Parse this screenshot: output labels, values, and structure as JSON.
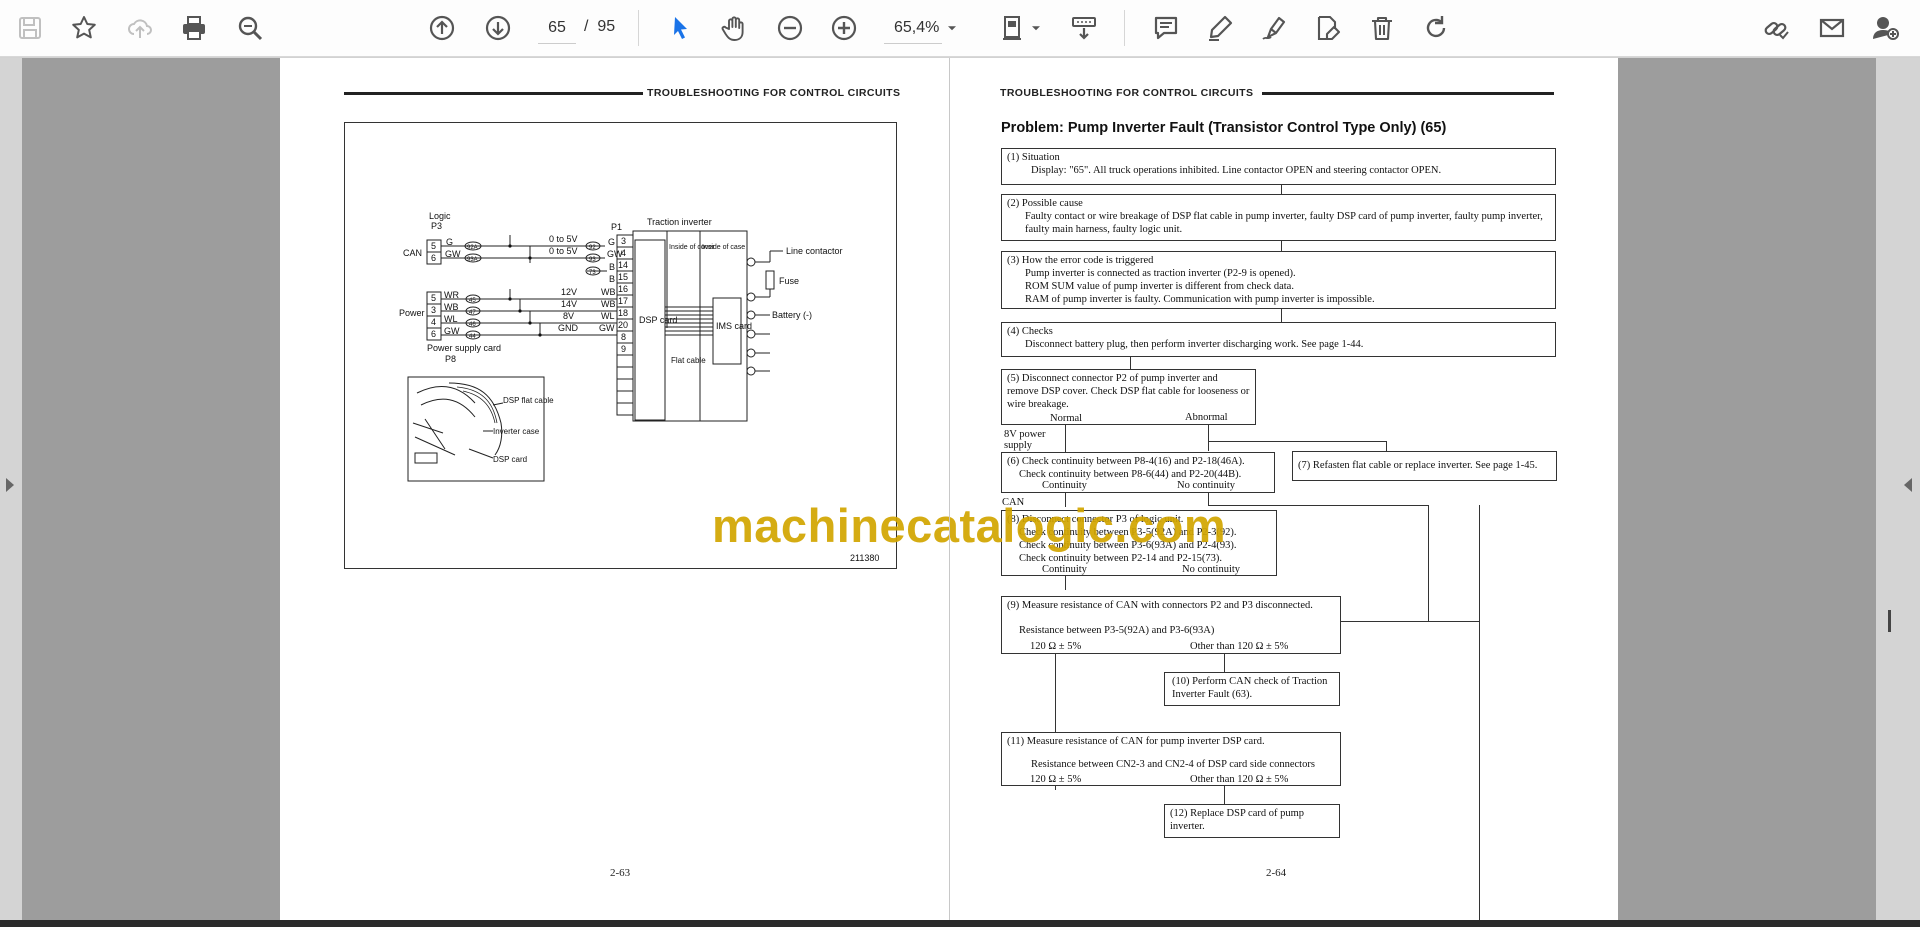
{
  "toolbar": {
    "page_current": "65",
    "page_separator": "/",
    "page_total": "95",
    "zoom": "65,4%"
  },
  "left_page": {
    "header": "TROUBLESHOOTING FOR CONTROL CIRCUITS",
    "page_number": "2-63",
    "figure_code": "211380",
    "diagram": {
      "logic": "Logic",
      "p3": "P3",
      "can": "CAN",
      "p1": "P1",
      "traction_inverter": "Traction inverter",
      "inside_cover": "Inside of cover",
      "inside_case": "Inside of case",
      "line_contactor": "Line contactor",
      "fuse": "Fuse",
      "battery": "Battery (-)",
      "dsp_card": "DSP card",
      "ims_card": "IMS card",
      "flat_cable": "Flat cable",
      "power": "Power",
      "power_supply_card": "Power supply card",
      "p8": "P8",
      "v0_5_a": "0 to 5V",
      "v0_5_b": "0 to 5V",
      "v12": "12V",
      "v14": "14V",
      "v8": "8V",
      "gnd": "GND",
      "g": "G",
      "gw": "GW",
      "b": "B",
      "wb": "WB",
      "wr": "WR",
      "wl": "WL",
      "pin5": "5",
      "pin6": "6",
      "pin3": "3",
      "pin4": "4",
      "pin14": "14",
      "pin15": "15",
      "pin16": "16",
      "pin17": "17",
      "pin18": "18",
      "pin20": "20",
      "pin8": "8",
      "pin9": "9",
      "w92a": "92A",
      "w93a": "93A",
      "w92": "92",
      "w93": "93",
      "w73": "73",
      "w45": "45",
      "w47": "47",
      "w46": "46",
      "w44": "44",
      "inset_dsp_flat": "DSP flat cable",
      "inset_inverter": "Inverter case",
      "inset_dsp": "DSP card"
    }
  },
  "right_page": {
    "header": "TROUBLESHOOTING FOR CONTROL CIRCUITS",
    "title": "Problem: Pump Inverter Fault (Transistor Control Type Only) (65)",
    "page_number": "2-64",
    "steps": {
      "s1_title": "(1) Situation",
      "s1_body": "Display: \"65\". All truck operations inhibited. Line contactor OPEN and steering contactor OPEN.",
      "s2_title": "(2) Possible cause",
      "s2_body": "Faulty contact or wire breakage of DSP flat cable in pump inverter, faulty DSP card of pump inverter, faulty pump inverter, faulty main harness, faulty logic unit.",
      "s3_title": "(3) How the error code is triggered",
      "s3_l1": "Pump inverter is connected as traction inverter (P2-9 is opened).",
      "s3_l2": "ROM SUM value of pump inverter is different from check data.",
      "s3_l3": "RAM of pump inverter is faulty. Communication with pump inverter is impossible.",
      "s4_title": "(4) Checks",
      "s4_body": "Disconnect battery plug, then perform inverter discharging work. See page 1-44.",
      "s5_body": "(5) Disconnect connector P2 of pump inverter and remove DSP cover. Check DSP flat cable for looseness or wire breakage.",
      "s5_normal": "Normal",
      "s5_abnormal": "Abnormal",
      "s6_label": "8V power supply",
      "s6_l1": "(6) Check continuity between P8-4(16) and P2-18(46A).",
      "s6_l2": "Check continuity between P8-6(44) and P2-20(44B).",
      "s6_cont": "Continuity",
      "s6_nocont": "No continuity",
      "s7_body": "(7) Refasten flat cable or replace inverter. See page 1-45.",
      "can_label": "CAN",
      "s8_l1": "(8) Disconnect connector P3 of logic unit.",
      "s8_l2": "Check continuity between P3-5(92A) and P2-3(92).",
      "s8_l3": "Check continuity between P3-6(93A) and P2-4(93).",
      "s8_l4": "Check continuity between P2-14 and P2-15(73).",
      "s8_cont": "Continuity",
      "s8_nocont": "No continuity",
      "s9_l1": "(9) Measure resistance of CAN with connectors P2 and P3 disconnected.",
      "s9_l2": "Resistance between P3-5(92A) and P3-6(93A)",
      "s9_ok": "120 Ω ± 5%",
      "s9_other": "Other than 120 Ω ± 5%",
      "s10_body": "(10) Perform CAN check of Traction Inverter Fault (63).",
      "s11_l1": "(11)  Measure resistance of CAN for pump inverter DSP card.",
      "s11_l2": "Resistance between CN2-3 and CN2-4 of DSP card side connectors",
      "s11_ok": "120 Ω ± 5%",
      "s11_other": "Other than 120 Ω ± 5%",
      "s12_body": "(12)  Replace DSP card of pump inverter."
    }
  },
  "watermark": "machinecatalogic.com",
  "colors": {
    "accent": "#1a73e8",
    "icon": "#555555",
    "watermark": "#d2a500",
    "viewer_bg": "#9d9d9d"
  }
}
